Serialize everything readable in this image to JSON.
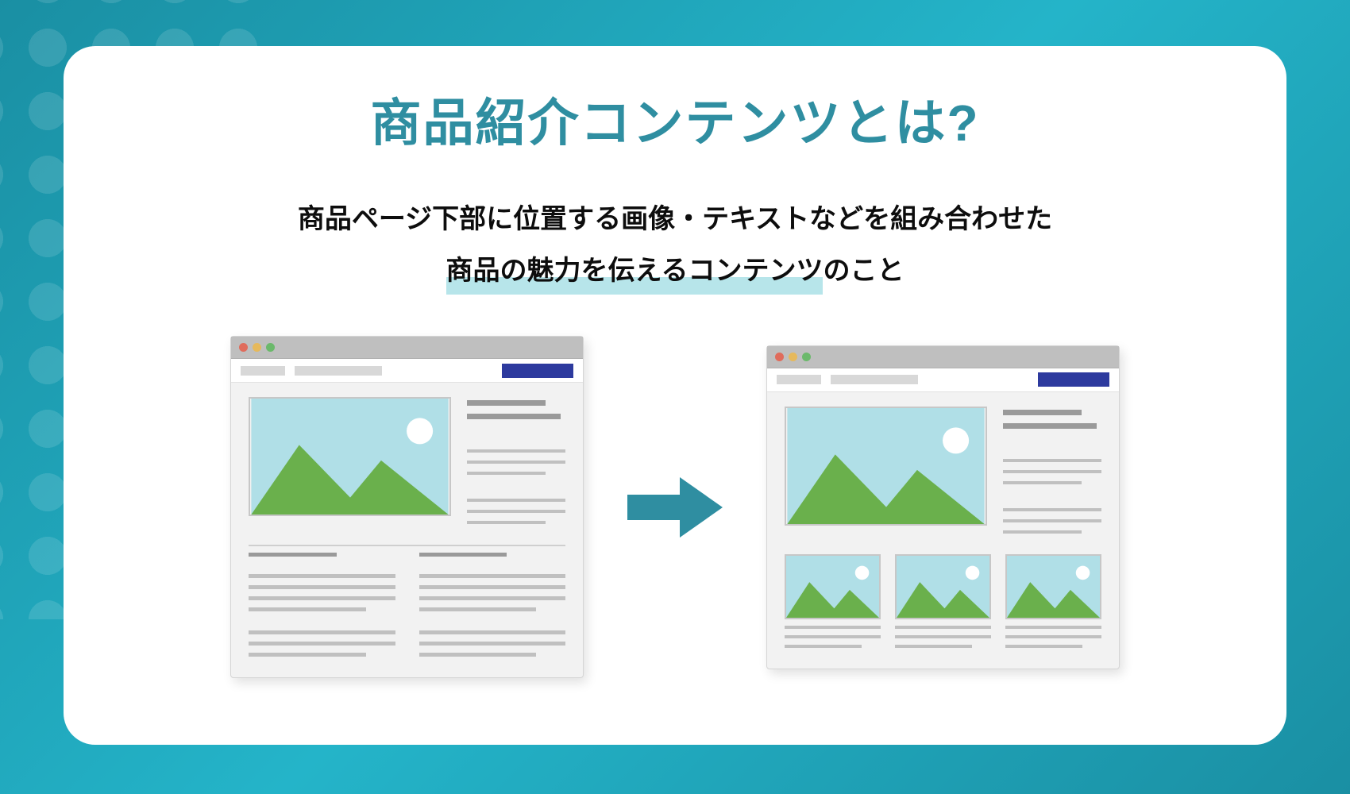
{
  "title": "商品紹介コンテンツとは?",
  "description": {
    "line1": "商品ページ下部に位置する画像・テキストなどを組み合わせた",
    "highlight": "商品の魅力を伝えるコンテンツ",
    "suffix": "のこと"
  },
  "colors": {
    "accent": "#2f8ea1",
    "highlight": "#b7e5ea",
    "cta": "#2d3a9e"
  },
  "left_panel": {
    "type": "before",
    "layout": "product-page-plain-text",
    "text_columns": 2
  },
  "right_panel": {
    "type": "after",
    "layout": "product-page-with-content-cards",
    "thumb_count": 3
  }
}
